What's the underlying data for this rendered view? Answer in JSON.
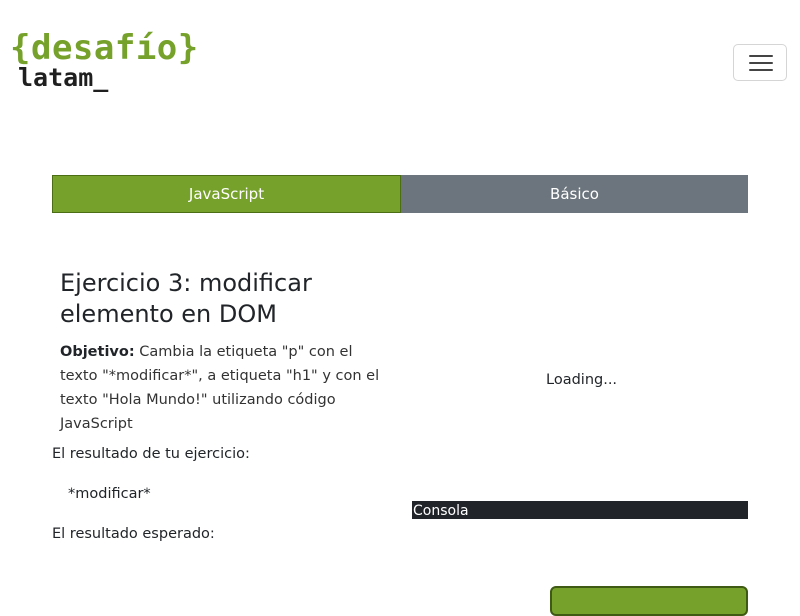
{
  "header": {
    "logo_top": "{desafío}",
    "logo_bottom": "latam_",
    "menu_icon": "hamburger-menu-icon"
  },
  "tabs": [
    {
      "label": "JavaScript",
      "active": true
    },
    {
      "label": "Básico",
      "active": false
    }
  ],
  "exercise": {
    "title": "Ejercicio 3: modificar elemento en DOM",
    "objective_label": "Objetivo:",
    "objective_text": " Cambia la etiqueta \"p\" con el texto \"*modificar*\", a etiqueta \"h1\" y con el texto \"Hola Mundo!\" utilizando código JavaScript",
    "result_label": "El resultado de tu ejercicio:",
    "result_value": "*modificar*",
    "expected_label": "El resultado esperado:"
  },
  "editor": {
    "loading_text": "Loading...",
    "console_label": "Consola"
  },
  "colors": {
    "accent": "#76a22c",
    "secondary": "#6c757d",
    "console_bg": "#212529"
  }
}
